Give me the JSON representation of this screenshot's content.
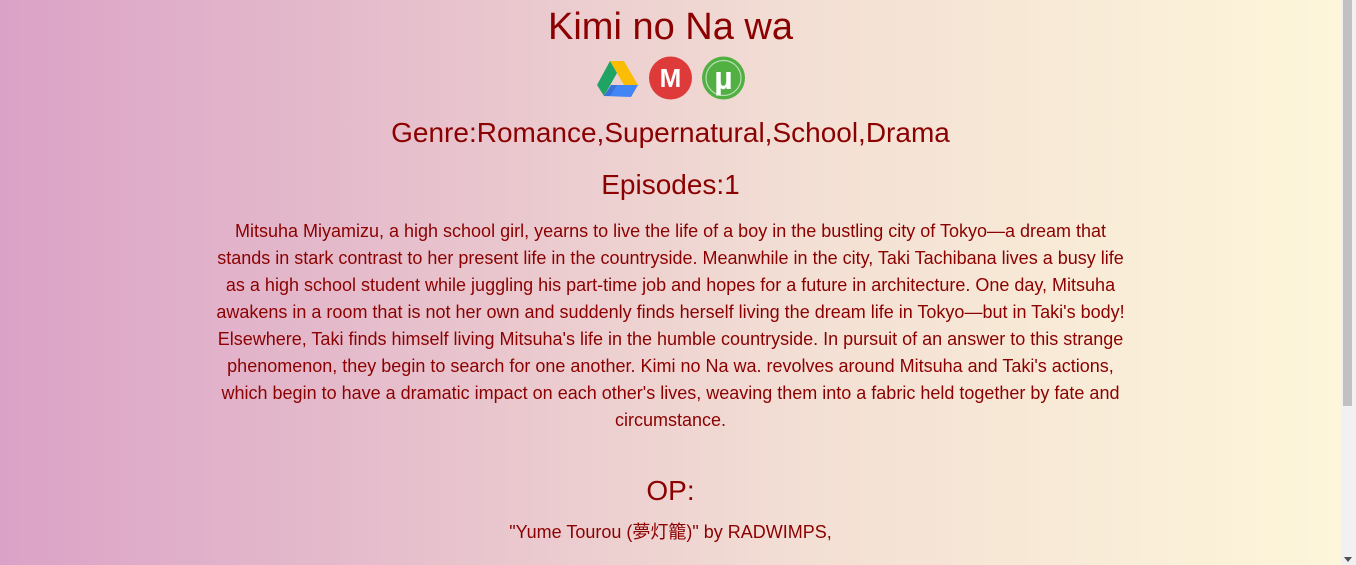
{
  "anime": {
    "title": "Kimi no Na wa",
    "genre": "Genre:Romance,Supernatural,School,Drama",
    "episodes": "Episodes:1",
    "synopsis": "Mitsuha Miyamizu, a high school girl, yearns to live the life of a boy in the bustling city of Tokyo—a dream that stands in stark contrast to her present life in the countryside. Meanwhile in the city, Taki Tachibana lives a busy life as a high school student while juggling his part-time job and hopes for a future in architecture. One day, Mitsuha awakens in a room that is not her own and suddenly finds herself living the dream life in Tokyo—but in Taki's body! Elsewhere, Taki finds himself living Mitsuha's life in the humble countryside. In pursuit of an answer to this strange phenomenon, they begin to search for one another. Kimi no Na wa. revolves around Mitsuha and Taki's actions, which begin to have a dramatic impact on each other's lives, weaving them into a fabric held together by fate and circumstance.",
    "op_heading": "OP:",
    "op_song": "\"Yume Tourou (夢灯籠)\" by RADWIMPS,"
  },
  "download_links": [
    {
      "icon": "google-drive-icon"
    },
    {
      "icon": "mega-icon",
      "letter": "M"
    },
    {
      "icon": "utorrent-icon",
      "letter": "µ"
    }
  ],
  "colors": {
    "text": "#8b0000",
    "gradient_start": "#dba2c7",
    "gradient_end": "#fdf6da",
    "mega_red": "#d9272e",
    "utorrent_green": "#4ba83f"
  }
}
